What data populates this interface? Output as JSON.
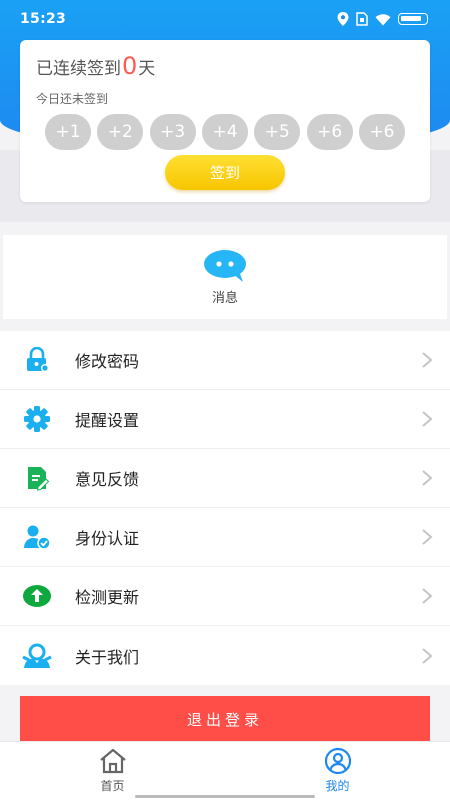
{
  "status_bar": {
    "time": "15:23"
  },
  "signin": {
    "streak_prefix": "已连续签到",
    "streak_days": "0",
    "streak_suffix": "天",
    "today_status": "今日还未签到",
    "days": [
      "+1",
      "+2",
      "+3",
      "+4",
      "+5",
      "+6",
      "+6"
    ],
    "button_label": "签到"
  },
  "message": {
    "label": "消息"
  },
  "menu": [
    {
      "label": "修改密码",
      "icon": "lock-icon"
    },
    {
      "label": "提醒设置",
      "icon": "gear-icon"
    },
    {
      "label": "意见反馈",
      "icon": "feedback-icon"
    },
    {
      "label": "身份认证",
      "icon": "user-verify-icon"
    },
    {
      "label": "检测更新",
      "icon": "update-icon"
    },
    {
      "label": "关于我们",
      "icon": "about-icon"
    }
  ],
  "logout": {
    "label": "退出登录"
  },
  "bottom_nav": [
    {
      "label": "首页",
      "icon": "home-icon",
      "active": false
    },
    {
      "label": "我的",
      "icon": "profile-icon",
      "active": true
    }
  ],
  "colors": {
    "header_blue": "#1e88f0",
    "accent_blue": "#1e88f0",
    "logout_red": "#ff4d47",
    "signin_yellow": "#f7c500",
    "streak_red": "#ff5a4e",
    "icon_green": "#1bb35a",
    "icon_cyan": "#1ab0f0"
  }
}
